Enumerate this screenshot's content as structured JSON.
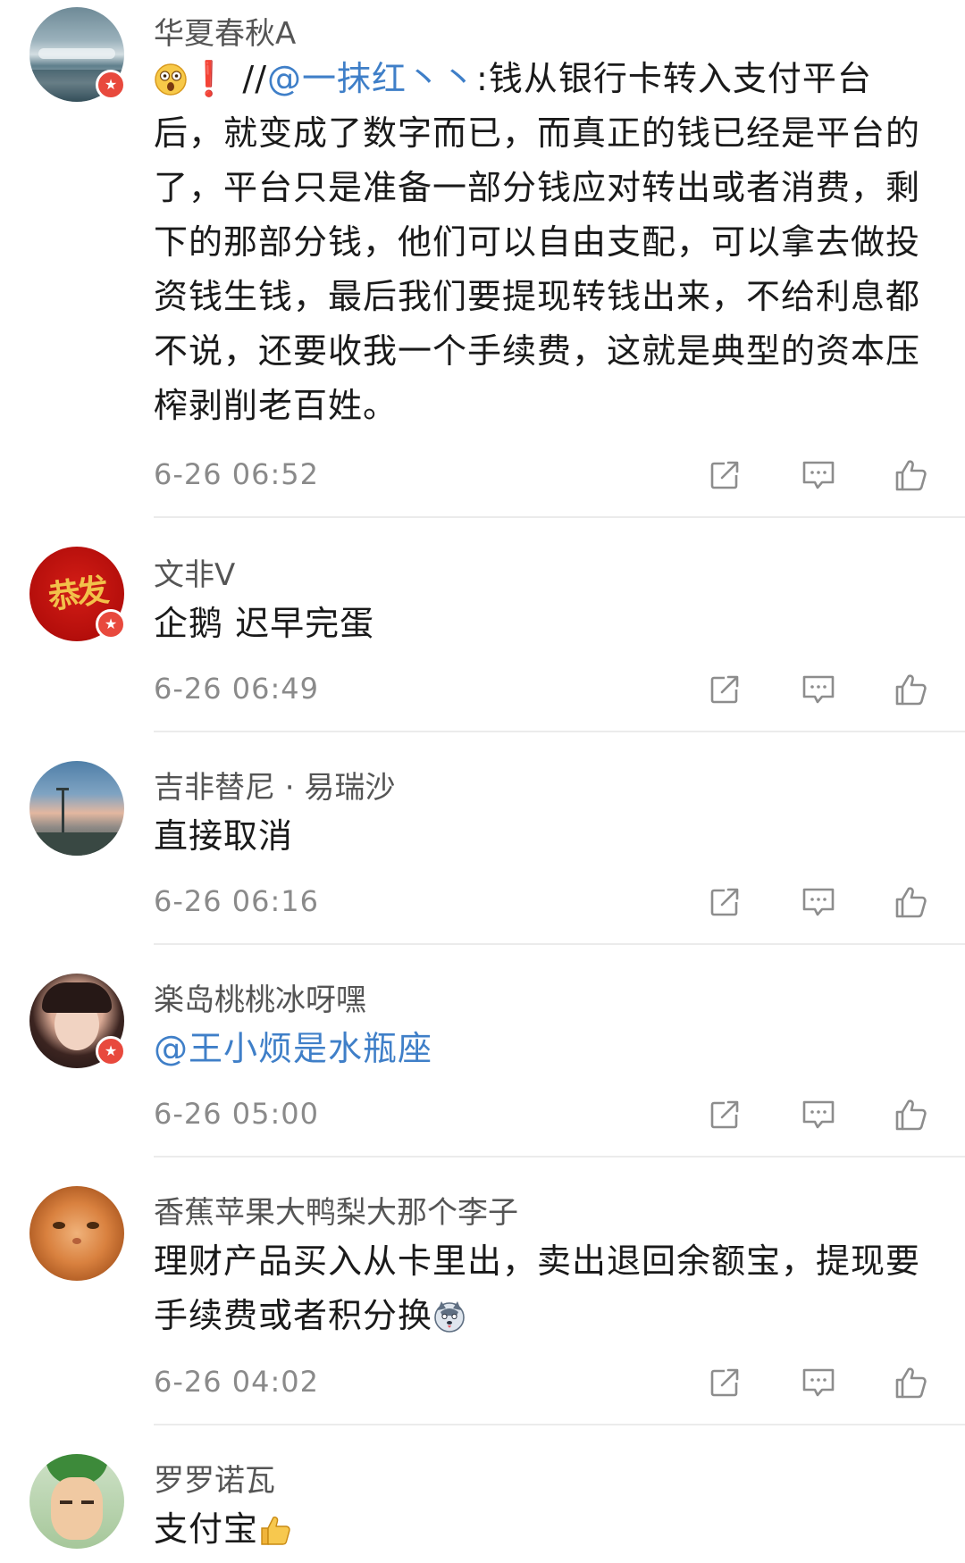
{
  "colors": {
    "mention": "#3f7fc8",
    "badge": "#e8493d",
    "muted": "#8a8a8a"
  },
  "comments": [
    {
      "username": "华夏春秋A",
      "content_prefix": "❗️ //",
      "mention": "@一抹红丶丶",
      "content": ":钱从银行卡转入支付平台后，就变成了数字而已，而真正的钱已经是平台的了，平台只是准备一部分钱应对转出或者消费，剩下的那部分钱，他们可以自由支配，可以拿去做投资钱生钱，最后我们要提现转钱出来，不给利息都不说，还要收我一个手续费，这就是典型的资本压榨剥削老百姓。",
      "time": "6-26 06:52",
      "verified": true,
      "avatar": "snowy-sea-landscape"
    },
    {
      "username": "文非V",
      "content": "企鹅 迟早完蛋",
      "time": "6-26 06:49",
      "verified": true,
      "avatar": "red-calligraphy-logo",
      "avatar_text": "恭发"
    },
    {
      "username": "吉非替尼 · 易瑞沙",
      "content": "直接取消",
      "time": "6-26 06:16",
      "verified": false,
      "avatar": "dusk-road-sky"
    },
    {
      "username": "楽岛桃桃冰呀嘿",
      "mention": "@王小烦是水瓶座",
      "time": "6-26 05:00",
      "verified": true,
      "avatar": "girl-portrait"
    },
    {
      "username": "香蕉苹果大鸭梨大那个李子",
      "content": "理财产品买入从卡里出，卖出退回余额宝，提现要手续费或者积分换",
      "time": "6-26 04:02",
      "verified": false,
      "avatar": "orange-cat"
    },
    {
      "username": "罗罗诺瓦",
      "content": "支付宝",
      "verified": false,
      "avatar": "anime-swordsman"
    }
  ],
  "icons": {
    "share": "share-icon",
    "reply": "comment-icon",
    "like": "thumbs-up-icon"
  }
}
